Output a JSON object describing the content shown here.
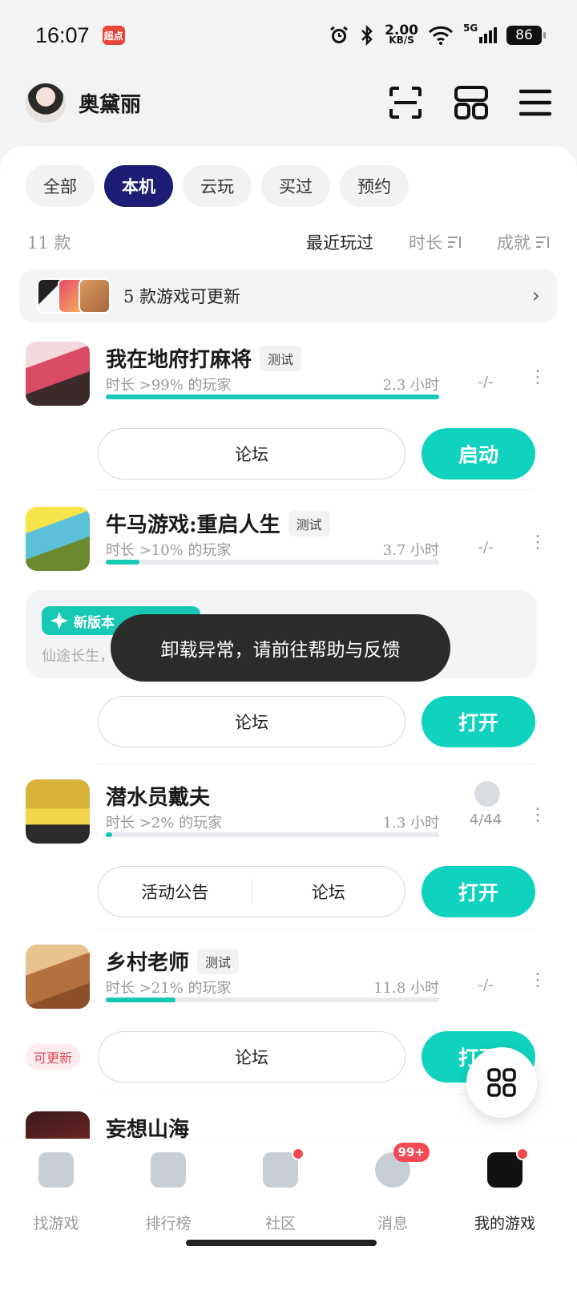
{
  "status_bar": {
    "time": "16:07",
    "app_badge": "超点",
    "net_speed_value": "2.00",
    "net_speed_unit": "KB/S",
    "network": "5G",
    "battery": "86"
  },
  "header": {
    "user_name": "奥黛丽"
  },
  "filters": [
    "全部",
    "本机",
    "云玩",
    "买过",
    "预约"
  ],
  "sort": {
    "count": "11 款",
    "recent": "最近玩过",
    "duration": "时长",
    "achievement": "成就"
  },
  "update_banner": {
    "text": "5 款游戏可更新",
    "chevron": "›"
  },
  "games": [
    {
      "title": "我在地府打麻将",
      "tag": "测试",
      "percentile": "时长 >99% 的玩家",
      "hours": "2.3 小时",
      "achievement": "-/-",
      "progress": 1.0,
      "actions": [
        "论坛"
      ],
      "primary": "启动"
    },
    {
      "title": "牛马游戏:重启人生",
      "tag": "测试",
      "percentile": "时长 >10% 的玩家",
      "hours": "3.7 小时",
      "achievement": "-/-",
      "progress": 0.1,
      "actions": [
        "论坛"
      ],
      "primary": "打开",
      "news_badge": "新版本",
      "news_desc": "仙途长生，"
    },
    {
      "title": "潜水员戴夫",
      "percentile": "时长 >2% 的玩家",
      "hours": "1.3 小时",
      "achievement": "4/44",
      "progress": 0.02,
      "actions": [
        "活动公告",
        "论坛"
      ],
      "primary": "打开"
    },
    {
      "title": "乡村老师",
      "tag": "测试",
      "percentile": "时长 >21% 的玩家",
      "hours": "11.8 小时",
      "achievement": "-/-",
      "progress": 0.21,
      "actions": [
        "论坛"
      ],
      "primary": "打开",
      "updatable": "可更新"
    },
    {
      "title": "妄想山海"
    }
  ],
  "toast": "卸载异常，请前往帮助与反馈",
  "tabs": [
    {
      "label": "找游戏"
    },
    {
      "label": "排行榜"
    },
    {
      "label": "社区"
    },
    {
      "label": "消息",
      "badge": "99+"
    },
    {
      "label": "我的游戏"
    }
  ],
  "colors": {
    "accent": "#0fd3bf",
    "active_chip": "#1b1e74",
    "badge_red": "#f34a55"
  }
}
